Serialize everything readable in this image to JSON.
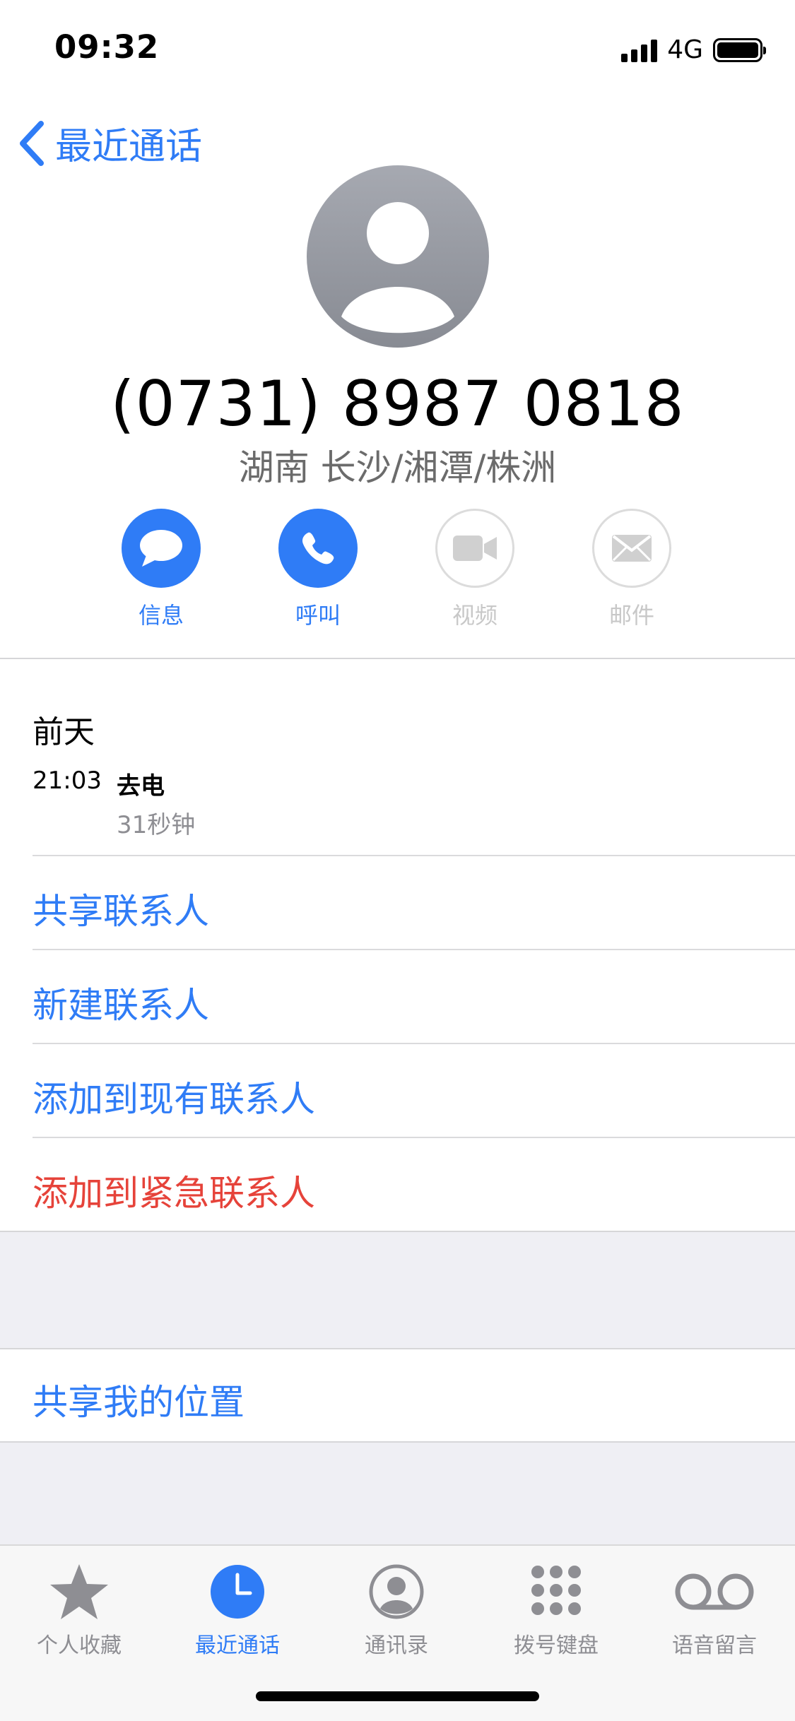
{
  "status_bar": {
    "time": "09:32",
    "network": "4G"
  },
  "nav": {
    "back_label": "最近通话"
  },
  "contact": {
    "phone": "(0731) 8987 0818",
    "location": "湖南 长沙/湘潭/株洲"
  },
  "actions": [
    {
      "label": "信息",
      "icon": "message-icon",
      "enabled": true
    },
    {
      "label": "呼叫",
      "icon": "phone-icon",
      "enabled": true
    },
    {
      "label": "视频",
      "icon": "video-icon",
      "enabled": false
    },
    {
      "label": "邮件",
      "icon": "mail-icon",
      "enabled": false
    }
  ],
  "call_history": {
    "day": "前天",
    "entries": [
      {
        "time": "21:03",
        "type": "去电",
        "duration": "31秒钟"
      }
    ]
  },
  "options": [
    {
      "label": "共享联系人"
    },
    {
      "label": "新建联系人"
    },
    {
      "label": "添加到现有联系人"
    },
    {
      "label": "添加到紧急联系人",
      "color": "#e6433a"
    }
  ],
  "location_option": {
    "label": "共享我的位置"
  },
  "tabs": [
    {
      "label": "个人收藏",
      "icon": "star-icon",
      "active": false
    },
    {
      "label": "最近通话",
      "icon": "clock-icon",
      "active": true
    },
    {
      "label": "通讯录",
      "icon": "contacts-icon",
      "active": false
    },
    {
      "label": "拨号键盘",
      "icon": "keypad-icon",
      "active": false
    },
    {
      "label": "语音留言",
      "icon": "voicemail-icon",
      "active": false
    }
  ],
  "colors": {
    "accent": "#2f7cf6",
    "danger": "#e6433a",
    "inactive": "#8e8e93",
    "disabled": "#c8c8c8"
  }
}
